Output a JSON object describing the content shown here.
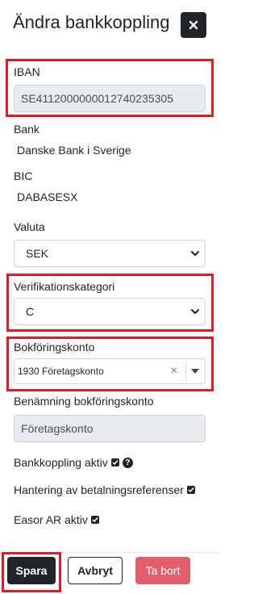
{
  "modal": {
    "title": "Ändra bankkoppling",
    "close_icon": "close-icon"
  },
  "fields": {
    "iban": {
      "label": "IBAN",
      "value": "SE4112000000012740235305"
    },
    "bank": {
      "label": "Bank",
      "value": "Danske Bank i Sverige"
    },
    "bic": {
      "label": "BIC",
      "value": "DABASESX"
    },
    "currency": {
      "label": "Valuta",
      "selected": "SEK"
    },
    "verification_category": {
      "label": "Verifikationskategori",
      "selected": "C"
    },
    "account": {
      "label": "Bokföringskonto",
      "selected": "1930 Företagskonto",
      "clear_glyph": "×"
    },
    "account_name": {
      "label": "Benämning bokföringskonto",
      "value": "Företagskonto"
    }
  },
  "checks": {
    "bank_link_active": {
      "label": "Bankkoppling aktiv",
      "checked": true,
      "help_glyph": "?"
    },
    "payment_refs": {
      "label": "Hantering av betalningsreferenser",
      "checked": true
    },
    "easor_ar": {
      "label": "Easor AR aktiv",
      "checked": true
    }
  },
  "footer": {
    "save_label": "Spara",
    "cancel_label": "Avbryt",
    "delete_label": "Ta bort"
  },
  "colors": {
    "highlight": "#e01b24",
    "primary_dark": "#212529",
    "danger": "#e35d6a",
    "disabled_bg": "#e9ecef"
  }
}
